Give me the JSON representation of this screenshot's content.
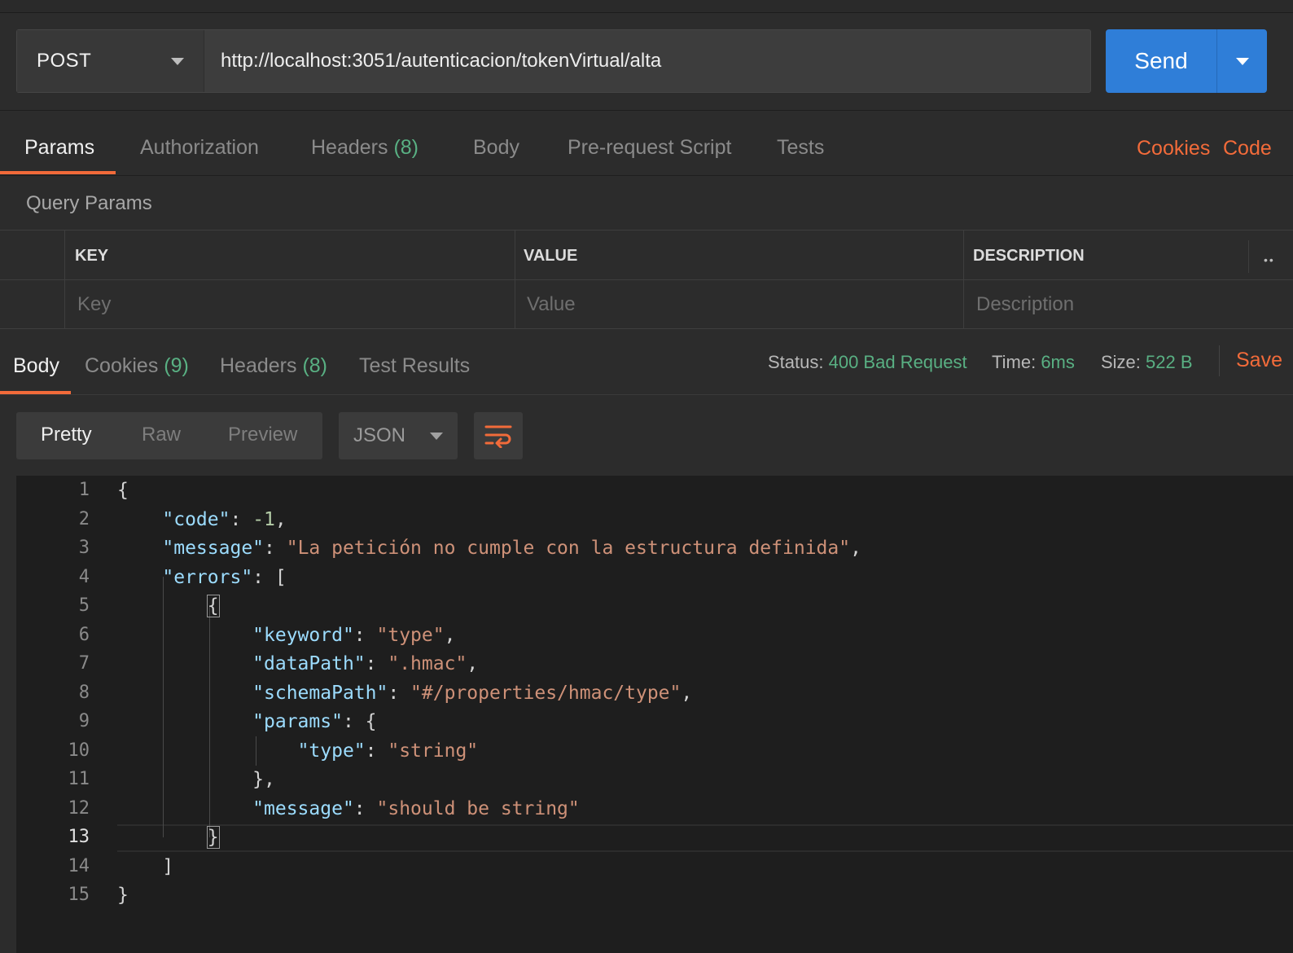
{
  "request": {
    "method": "POST",
    "url": "http://localhost:3051/autenticacion/tokenVirtual/alta",
    "send_label": "Send"
  },
  "request_tabs": {
    "params": "Params",
    "authorization": "Authorization",
    "headers": "Headers",
    "headers_count": "(8)",
    "body": "Body",
    "prerequest": "Pre-request Script",
    "tests": "Tests",
    "cookies": "Cookies",
    "code": "Code"
  },
  "query_params": {
    "title": "Query Params",
    "columns": [
      "KEY",
      "VALUE",
      "DESCRIPTION"
    ],
    "placeholders": {
      "key": "Key",
      "value": "Value",
      "description": "Description"
    }
  },
  "response_tabs": {
    "body": "Body",
    "cookies": "Cookies",
    "cookies_count": "(9)",
    "headers": "Headers",
    "headers_count": "(8)",
    "test_results": "Test Results"
  },
  "response_meta": {
    "status_label": "Status:",
    "status_value": "400 Bad Request",
    "time_label": "Time:",
    "time_value": "6ms",
    "size_label": "Size:",
    "size_value": "522 B",
    "save_label": "Save"
  },
  "viewer": {
    "modes": [
      "Pretty",
      "Raw",
      "Preview"
    ],
    "active_mode": "Pretty",
    "format": "JSON",
    "wrap_icon": "wrap-lines-icon"
  },
  "code": {
    "current_line": 13,
    "lines": [
      "{",
      "    \"code\": -1,",
      "    \"message\": \"La petición no cumple con la estructura definida\",",
      "    \"errors\": [",
      "        {",
      "            \"keyword\": \"type\",",
      "            \"dataPath\": \".hmac\",",
      "            \"schemaPath\": \"#/properties/hmac/type\",",
      "            \"params\": {",
      "                \"type\": \"string\"",
      "            },",
      "            \"message\": \"should be string\"",
      "        }",
      "    ]",
      "}"
    ]
  },
  "colors": {
    "accent": "#f26b3a",
    "send": "#2f7ed8",
    "status_ok": "#59b083",
    "json_key": "#9cdcfe",
    "json_string": "#ce9178",
    "json_number": "#b5cea8"
  }
}
